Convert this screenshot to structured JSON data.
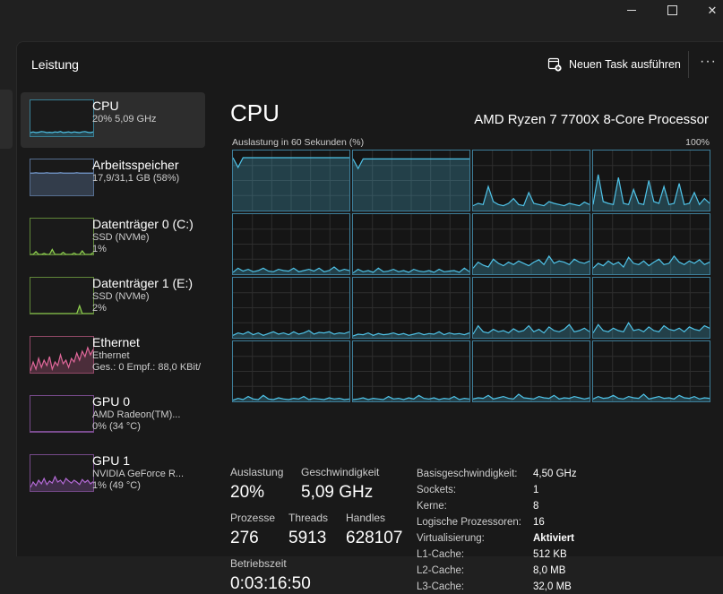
{
  "window": {
    "min_glyph": "",
    "close_glyph": "✕"
  },
  "header": {
    "title": "Leistung",
    "new_task_label": "Neuen Task ausführen",
    "more_glyph": "···"
  },
  "sidebar": {
    "items": [
      {
        "title": "CPU",
        "sub1": "20%  5,09 GHz",
        "sub2": "",
        "sub3": "",
        "color": "#4fc3e8",
        "values": [
          10,
          12,
          10,
          11,
          13,
          12,
          10,
          11,
          10,
          12,
          11,
          13,
          10,
          11,
          12,
          10,
          12,
          11,
          10,
          12,
          13,
          11,
          10,
          12
        ],
        "active": true
      },
      {
        "title": "Arbeitsspeicher",
        "sub1": "17,9/31,1 GB (58%)",
        "sub2": "",
        "sub3": "",
        "color": "#7ea7e0",
        "values": [
          62,
          62,
          63,
          62,
          62,
          62,
          63,
          62,
          62,
          62,
          62,
          63,
          62,
          62,
          62,
          62,
          62,
          63,
          62,
          62,
          62,
          62,
          62,
          62
        ],
        "active": false
      },
      {
        "title": "Datenträger 0 (C:)",
        "sub1": "SSD (NVMe)",
        "sub2": "1%",
        "sub3": "",
        "color": "#8fd14f",
        "values": [
          0,
          0,
          8,
          0,
          0,
          3,
          0,
          0,
          14,
          0,
          0,
          0,
          6,
          0,
          0,
          0,
          4,
          0,
          0,
          10,
          0,
          0,
          0,
          5
        ],
        "active": false
      },
      {
        "title": "Datenträger 1 (E:)",
        "sub1": "SSD (NVMe)",
        "sub2": "2%",
        "sub3": "",
        "color": "#8fd14f",
        "values": [
          0,
          0,
          0,
          0,
          0,
          0,
          0,
          0,
          0,
          0,
          0,
          0,
          0,
          0,
          0,
          0,
          0,
          0,
          22,
          0,
          0,
          0,
          0,
          0
        ],
        "active": false
      },
      {
        "title": "Ethernet",
        "sub1": "Ethernet",
        "sub2": "Ges.: 0 Empf.: 88,0 KBit/",
        "sub3": "",
        "color": "#e0679a",
        "values": [
          5,
          30,
          10,
          40,
          15,
          35,
          20,
          45,
          10,
          30,
          20,
          50,
          25,
          35,
          15,
          40,
          30,
          55,
          35,
          60,
          45,
          70,
          50,
          65
        ],
        "active": false
      },
      {
        "title": "GPU 0",
        "sub1": "AMD Radeon(TM)...",
        "sub2": "0%  (34 °C)",
        "sub3": "",
        "color": "#b46ad6",
        "values": [
          0,
          0,
          0,
          0,
          0,
          0,
          0,
          0,
          0,
          0,
          0,
          0,
          0,
          0,
          0,
          0,
          0,
          0,
          0,
          0,
          0,
          0,
          0,
          0
        ],
        "active": false
      },
      {
        "title": "GPU 1",
        "sub1": "NVIDIA GeForce R...",
        "sub2": "1%  (49 °C)",
        "sub3": "",
        "color": "#b46ad6",
        "values": [
          10,
          25,
          15,
          30,
          20,
          35,
          18,
          28,
          22,
          40,
          25,
          30,
          20,
          35,
          28,
          22,
          30,
          25,
          18,
          32,
          24,
          30,
          20,
          26
        ],
        "active": false
      }
    ]
  },
  "main": {
    "title": "CPU",
    "model": "AMD Ryzen 7 7700X 8-Core Processor",
    "util_label": "Auslastung in 60 Sekunden (%)",
    "util_max": "100%",
    "graph_color": "#4fc3e8",
    "cores": [
      {
        "values": [
          88,
          72,
          88,
          88,
          88,
          88,
          88,
          88,
          88,
          88,
          88,
          88,
          88,
          88,
          88,
          88,
          88,
          88,
          88,
          88,
          88,
          88,
          88,
          88
        ]
      },
      {
        "values": [
          86,
          70,
          86,
          86,
          86,
          86,
          86,
          86,
          86,
          86,
          86,
          86,
          86,
          86,
          86,
          86,
          86,
          86,
          86,
          86,
          86,
          86,
          86,
          86
        ]
      },
      {
        "values": [
          8,
          12,
          10,
          40,
          15,
          10,
          8,
          12,
          20,
          10,
          8,
          30,
          12,
          10,
          8,
          15,
          12,
          10,
          8,
          12,
          10,
          8,
          14,
          10
        ]
      },
      {
        "values": [
          10,
          60,
          15,
          12,
          10,
          55,
          12,
          10,
          35,
          12,
          10,
          50,
          15,
          12,
          40,
          10,
          12,
          45,
          10,
          12,
          30,
          10,
          20,
          12
        ]
      },
      {
        "values": [
          3,
          10,
          5,
          8,
          4,
          6,
          10,
          5,
          4,
          8,
          6,
          5,
          10,
          4,
          6,
          8,
          5,
          10,
          4,
          6,
          12,
          5,
          8,
          6
        ]
      },
      {
        "values": [
          2,
          8,
          4,
          6,
          3,
          10,
          4,
          5,
          8,
          4,
          6,
          3,
          8,
          5,
          4,
          6,
          3,
          8,
          4,
          5,
          6,
          3,
          10,
          4
        ]
      },
      {
        "values": [
          10,
          20,
          15,
          12,
          25,
          18,
          14,
          20,
          16,
          22,
          18,
          14,
          20,
          24,
          16,
          30,
          18,
          22,
          20,
          16,
          25,
          20,
          18,
          22
        ]
      },
      {
        "values": [
          10,
          18,
          14,
          22,
          16,
          20,
          12,
          28,
          18,
          16,
          22,
          14,
          20,
          25,
          16,
          18,
          30,
          20,
          16,
          22,
          18,
          24,
          16,
          20
        ]
      },
      {
        "values": [
          4,
          8,
          6,
          10,
          5,
          8,
          4,
          7,
          10,
          6,
          8,
          5,
          10,
          6,
          8,
          12,
          6,
          9,
          8,
          10,
          6,
          8,
          7,
          10
        ]
      },
      {
        "values": [
          3,
          6,
          5,
          8,
          4,
          7,
          5,
          6,
          8,
          5,
          7,
          4,
          6,
          8,
          5,
          7,
          6,
          10,
          5,
          8,
          6,
          7,
          5,
          8
        ]
      },
      {
        "values": [
          6,
          20,
          10,
          8,
          14,
          10,
          12,
          8,
          15,
          10,
          12,
          20,
          10,
          14,
          8,
          18,
          12,
          10,
          14,
          22,
          10,
          12,
          16,
          10
        ]
      },
      {
        "values": [
          8,
          22,
          12,
          10,
          16,
          12,
          10,
          25,
          12,
          14,
          10,
          18,
          12,
          10,
          20,
          14,
          12,
          16,
          10,
          18,
          14,
          12,
          20,
          16
        ]
      },
      {
        "values": [
          2,
          5,
          3,
          8,
          4,
          3,
          10,
          4,
          3,
          6,
          4,
          3,
          5,
          4,
          8,
          3,
          5,
          4,
          3,
          6,
          4,
          5,
          3,
          4
        ]
      },
      {
        "values": [
          3,
          4,
          6,
          3,
          5,
          4,
          3,
          8,
          4,
          5,
          3,
          6,
          4,
          10,
          5,
          4,
          6,
          3,
          5,
          4,
          8,
          3,
          5,
          4
        ]
      },
      {
        "values": [
          4,
          6,
          5,
          10,
          4,
          6,
          8,
          5,
          4,
          12,
          6,
          5,
          4,
          8,
          6,
          5,
          10,
          4,
          6,
          5,
          8,
          6,
          4,
          6
        ]
      },
      {
        "values": [
          4,
          8,
          5,
          6,
          10,
          5,
          4,
          8,
          6,
          5,
          12,
          4,
          6,
          8,
          5,
          6,
          4,
          10,
          6,
          5,
          8,
          4,
          6,
          5
        ]
      }
    ]
  },
  "stats": {
    "auslastung_label": "Auslastung",
    "auslastung_value": "20%",
    "geschw_label": "Geschwindigkeit",
    "geschw_value": "5,09 GHz",
    "prozesse_label": "Prozesse",
    "prozesse_value": "276",
    "threads_label": "Threads",
    "threads_value": "5913",
    "handles_label": "Handles",
    "handles_value": "628107",
    "betriebszeit_label": "Betriebszeit",
    "betriebszeit_value": "0:03:16:50"
  },
  "specs": [
    {
      "key": "Basisgeschwindigkeit:",
      "value": "4,50 GHz",
      "bold": false
    },
    {
      "key": "Sockets:",
      "value": "1",
      "bold": false
    },
    {
      "key": "Kerne:",
      "value": "8",
      "bold": false
    },
    {
      "key": "Logische Prozessoren:",
      "value": "16",
      "bold": false
    },
    {
      "key": "Virtualisierung:",
      "value": "Aktiviert",
      "bold": true
    },
    {
      "key": "L1-Cache:",
      "value": "512 KB",
      "bold": false
    },
    {
      "key": "L2-Cache:",
      "value": "8,0 MB",
      "bold": false
    },
    {
      "key": "L3-Cache:",
      "value": "32,0 MB",
      "bold": false
    }
  ]
}
